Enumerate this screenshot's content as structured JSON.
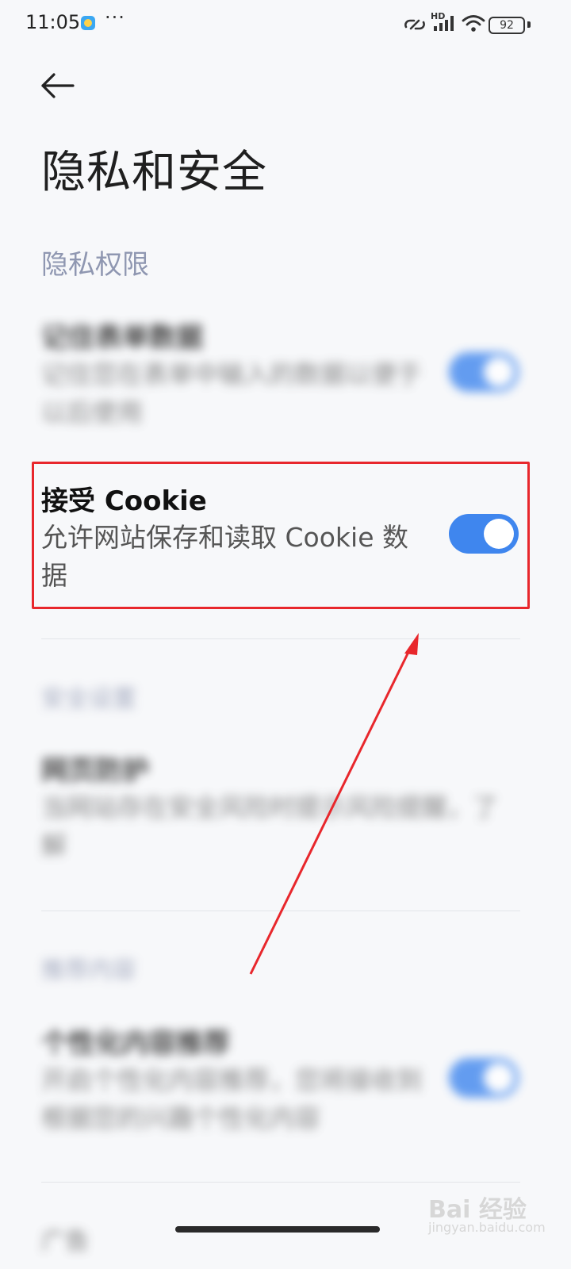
{
  "status_bar": {
    "time": "11:05",
    "more": "···",
    "battery": "92",
    "network_label": "HD"
  },
  "header": {
    "title": "隐私和安全"
  },
  "sections": {
    "privacy": {
      "label": "隐私权限",
      "rows": [
        {
          "title": "记住表单数据",
          "subtitle": "记住您在表单中输入的数据以便于以后使用",
          "enabled": true
        },
        {
          "title": "接受 Cookie",
          "subtitle": "允许网站保存和读取 Cookie 数据",
          "enabled": true
        }
      ]
    },
    "security": {
      "label": "安全设置",
      "rows": [
        {
          "title": "网页防护",
          "subtitle": "当网站存在安全风险时提示风险提醒，了解"
        }
      ]
    },
    "content": {
      "label": "推荐内容",
      "rows": [
        {
          "title": "个性化内容推荐",
          "subtitle": "开启个性化内容推荐，您将接收到根据您的兴趣个性化内容",
          "enabled": true
        }
      ]
    },
    "ads": {
      "label": "广告"
    }
  },
  "watermark": {
    "brand": "Bai 经验",
    "url": "jingyan.baidu.com"
  },
  "colors": {
    "accent": "#3f86ee",
    "highlight": "#e8272c",
    "section_label": "#8f97b1"
  }
}
